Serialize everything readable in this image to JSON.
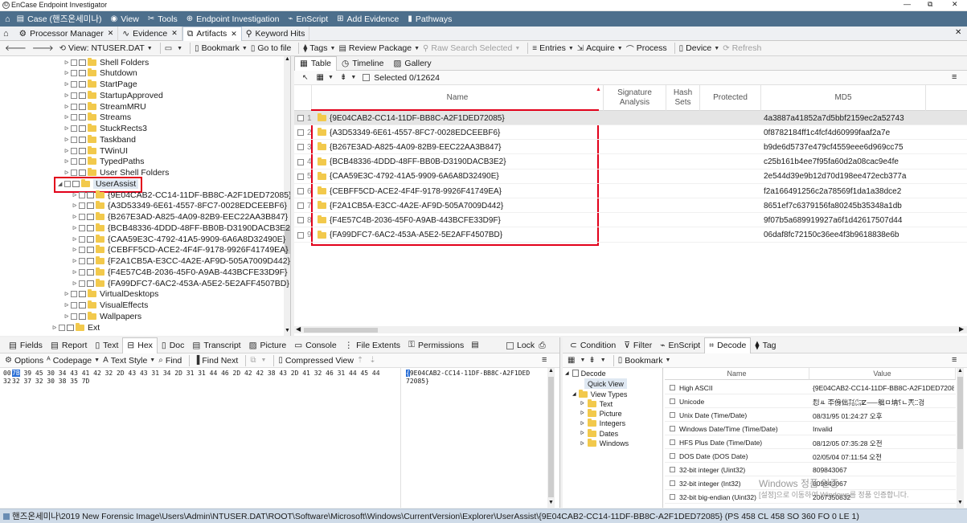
{
  "window": {
    "title": "EnCase Endpoint Investigator",
    "controls": [
      "—",
      "⧉",
      "✕"
    ]
  },
  "menu": {
    "items": [
      {
        "icon": "case-icon",
        "label": "Case (핸즈온세미나)"
      },
      {
        "icon": "view-icon",
        "label": "View"
      },
      {
        "icon": "tools-icon",
        "label": "Tools"
      },
      {
        "icon": "endpoint-icon",
        "label": "Endpoint Investigation"
      },
      {
        "icon": "enscript-icon",
        "label": "EnScript"
      },
      {
        "icon": "evidence-icon",
        "label": "Add Evidence"
      },
      {
        "icon": "pathways-icon",
        "label": "Pathways"
      }
    ]
  },
  "tabs": [
    {
      "label": "Processor Manager",
      "active": false
    },
    {
      "label": "Evidence",
      "active": false
    },
    {
      "label": "Artifacts",
      "active": true
    },
    {
      "label": "Keyword Hits",
      "active": false
    }
  ],
  "toolbar": {
    "view_label": "View: NTUSER.DAT",
    "bookmark": "Bookmark",
    "goto": "Go to file",
    "tags": "Tags",
    "review": "Review Package",
    "raw_search": "Raw Search Selected",
    "entries": "Entries",
    "acquire": "Acquire",
    "process": "Process",
    "device": "Device",
    "refresh": "Refresh"
  },
  "tree": {
    "nodes": [
      {
        "label": "Shell Folders",
        "level": 0,
        "selected": false
      },
      {
        "label": "Shutdown",
        "level": 0,
        "selected": false
      },
      {
        "label": "StartPage",
        "level": 0,
        "selected": false
      },
      {
        "label": "StartupApproved",
        "level": 0,
        "selected": false
      },
      {
        "label": "StreamMRU",
        "level": 0,
        "selected": false
      },
      {
        "label": "Streams",
        "level": 0,
        "selected": false
      },
      {
        "label": "StuckRects3",
        "level": 0,
        "selected": false
      },
      {
        "label": "Taskband",
        "level": 0,
        "selected": false
      },
      {
        "label": "TWinUI",
        "level": 0,
        "selected": false
      },
      {
        "label": "TypedPaths",
        "level": 0,
        "selected": false
      },
      {
        "label": "User Shell Folders",
        "level": 0,
        "selected": false
      },
      {
        "label": "UserAssist",
        "level": 0,
        "selected": true
      },
      {
        "label": "{9E04CAB2-CC14-11DF-BB8C-A2F1DED72085}",
        "level": 1,
        "selected": false
      },
      {
        "label": "{A3D53349-6E61-4557-8FC7-0028EDCEEBF6}",
        "level": 1,
        "selected": false
      },
      {
        "label": "{B267E3AD-A825-4A09-82B9-EEC22AA3B847}",
        "level": 1,
        "selected": false
      },
      {
        "label": "{BCB48336-4DDD-48FF-BB0B-D3190DACB3E2}",
        "level": 1,
        "selected": false
      },
      {
        "label": "{CAA59E3C-4792-41A5-9909-6A6A8D32490E}",
        "level": 1,
        "selected": false
      },
      {
        "label": "{CEBFF5CD-ACE2-4F4F-9178-9926F41749EA}",
        "level": 1,
        "selected": false
      },
      {
        "label": "{F2A1CB5A-E3CC-4A2E-AF9D-505A7009D442}",
        "level": 1,
        "selected": false
      },
      {
        "label": "{F4E57C4B-2036-45F0-A9AB-443BCFE33D9F}",
        "level": 1,
        "selected": false
      },
      {
        "label": "{FA99DFC7-6AC2-453A-A5E2-5E2AFF4507BD}",
        "level": 1,
        "selected": false
      },
      {
        "label": "VirtualDesktops",
        "level": 0,
        "selected": false
      },
      {
        "label": "VisualEffects",
        "level": 0,
        "selected": false
      },
      {
        "label": "Wallpapers",
        "level": 0,
        "selected": false
      },
      {
        "label": "Ext",
        "level": -1,
        "selected": false
      }
    ]
  },
  "table": {
    "subtabs": [
      "Table",
      "Timeline",
      "Gallery"
    ],
    "selected_count": "Selected 0/12624",
    "columns": [
      "Name",
      "Signature Analysis",
      "Hash Sets",
      "Protected",
      "MD5"
    ],
    "rows": [
      {
        "num": "1",
        "name": "{9E04CAB2-CC14-11DF-BB8C-A2F1DED72085}",
        "md5": "4a3887a41852a7d5bbf2159ec2a52743"
      },
      {
        "num": "2",
        "name": "{A3D53349-6E61-4557-8FC7-0028EDCEEBF6}",
        "md5": "0f8782184ff1c4fcf4d60999faaf2a7e"
      },
      {
        "num": "3",
        "name": "{B267E3AD-A825-4A09-82B9-EEC22AA3B847}",
        "md5": "b9de6d5737e479cf4559eee6d969cc75"
      },
      {
        "num": "4",
        "name": "{BCB48336-4DDD-48FF-BB0B-D3190DACB3E2}",
        "md5": "c25b161b4ee7f95fa60d2a08cac9e4fe"
      },
      {
        "num": "5",
        "name": "{CAA59E3C-4792-41A5-9909-6A6A8D32490E}",
        "md5": "2e544d39e9b12d70d198ee472ecb377a"
      },
      {
        "num": "6",
        "name": "{CEBFF5CD-ACE2-4F4F-9178-9926F41749EA}",
        "md5": "f2a166491256c2a78569f1da1a38dce2"
      },
      {
        "num": "7",
        "name": "{F2A1CB5A-E3CC-4A2E-AF9D-505A7009D442}",
        "md5": "8651ef7c6379156fa80245b35348a1db"
      },
      {
        "num": "8",
        "name": "{F4E57C4B-2036-45F0-A9AB-443BCFE33D9F}",
        "md5": "9f07b5a689919927a6f1d42617507d44"
      },
      {
        "num": "9",
        "name": "{FA99DFC7-6AC2-453A-A5E2-5E2AFF4507BD}",
        "md5": "06daf8fc72150c36ee4f3b9618838e6b"
      }
    ]
  },
  "bottom_left": {
    "tabs": [
      "Fields",
      "Report",
      "Text",
      "Hex",
      "Doc",
      "Transcript",
      "Picture",
      "Console",
      "File Extents",
      "Permissions"
    ],
    "active_tab": "Hex",
    "lock": "Lock",
    "tools": {
      "options": "Options",
      "codepage": "Codepage",
      "textstyle": "Text Style",
      "find": "Find",
      "findnext": "Find Next",
      "compressed": "Compressed View"
    },
    "hex_line1_first": "7B",
    "hex_line1_rest": " 39 45 30 34 43 41 42 32 2D 43 43 31 34 2D 31 31 44 46 2D 42 42 38 43 2D 41 32 46 31 44 45 44",
    "hex_line2": "32 37 32 30 38 35 7D",
    "text_line1_first": "{",
    "text_line1_rest": "9E04CAB2-CC14-11DF-BB8C-A2F1DED",
    "text_line2": "72085}",
    "offsets": [
      "00",
      "32"
    ]
  },
  "bottom_right": {
    "tabs": [
      "Condition",
      "Filter",
      "EnScript",
      "Decode",
      "Tag"
    ],
    "active_tab": "Decode",
    "bookmark": "Bookmark",
    "tree": {
      "root": "Decode",
      "quick": "Quick View",
      "viewtypes": "View Types",
      "children": [
        "Text",
        "Picture",
        "Integers",
        "Dates",
        "Windows"
      ]
    },
    "columns": [
      "Name",
      "Value"
    ],
    "rows": [
      {
        "name": "High ASCII",
        "value": "{9E04CAB2-CC14-11DF-BB8C-A2F1DED72085}"
      },
      {
        "name": "Unicode",
        "value": "㤠ㅻ 㔻⵬㑗㑁㍃㌭ⵇ﻿⸺䠳ㅁ㘱⸮ㄴ兲ⵆ겅"
      },
      {
        "name": "Unix Date (Time/Date)",
        "value": "08/31/95 01:24:27 오후"
      },
      {
        "name": "Windows Date/Time (Time/Date)",
        "value": "Invalid"
      },
      {
        "name": "HFS Plus Date (Time/Date)",
        "value": "08/12/05 07:35:28 오전"
      },
      {
        "name": "DOS Date (DOS Date)",
        "value": "02/05/04 07:11:54 오전"
      },
      {
        "name": "32-bit integer (Uint32)",
        "value": "809843067"
      },
      {
        "name": "32-bit integer (Int32)",
        "value": "809843067"
      },
      {
        "name": "32-bit big-endian (Uint32)",
        "value": "2067350832"
      }
    ],
    "watermark_title": "Windows 정품 인증",
    "watermark_sub": "[설정]으로 이동하여 Windows를 정품 인증합니다."
  },
  "status": {
    "path": "핸즈온세미나\\2019 New Forensic Image\\Users\\Admin\\NTUSER.DAT\\ROOT\\Software\\Microsoft\\Windows\\CurrentVersion\\Explorer\\UserAssist\\{9E04CAB2-CC14-11DF-BB8C-A2F1DED72085} (PS 458 CL 458 SO 360 FO 0 LE 1)"
  },
  "colors": {
    "menubar": "#4d6f8c",
    "highlight": "#e2001a",
    "selection": "#2a6fd6",
    "folder": "#f2c94c"
  }
}
